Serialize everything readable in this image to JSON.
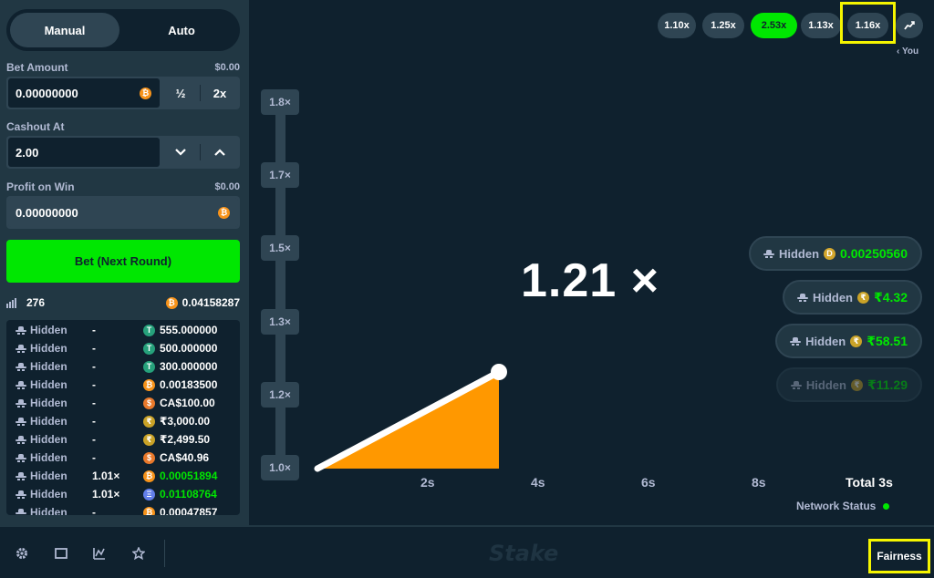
{
  "sidebar": {
    "modes": [
      "Manual",
      "Auto"
    ],
    "bet_amount": {
      "label": "Bet Amount",
      "usd": "$0.00",
      "value": "0.00000000",
      "half": "½",
      "double": "2x"
    },
    "cashout": {
      "label": "Cashout At",
      "value": "2.00"
    },
    "profit": {
      "label": "Profit on Win",
      "usd": "$0.00",
      "value": "0.00000000"
    },
    "bet_button": "Bet (Next Round)",
    "players": {
      "count": "276",
      "total": "0.04158287"
    },
    "bets": [
      {
        "user": "Hidden",
        "mult": "-",
        "coin": "usdt",
        "amount": "555.000000",
        "win": false
      },
      {
        "user": "Hidden",
        "mult": "-",
        "coin": "usdt",
        "amount": "500.000000",
        "win": false
      },
      {
        "user": "Hidden",
        "mult": "-",
        "coin": "usdt",
        "amount": "300.000000",
        "win": false
      },
      {
        "user": "Hidden",
        "mult": "-",
        "coin": "btc",
        "amount": "0.00183500",
        "win": false
      },
      {
        "user": "Hidden",
        "mult": "-",
        "coin": "cad",
        "amount": "CA$100.00",
        "win": false
      },
      {
        "user": "Hidden",
        "mult": "-",
        "coin": "inr",
        "amount": "₹3,000.00",
        "win": false
      },
      {
        "user": "Hidden",
        "mult": "-",
        "coin": "inr",
        "amount": "₹2,499.50",
        "win": false
      },
      {
        "user": "Hidden",
        "mult": "-",
        "coin": "cad",
        "amount": "CA$40.96",
        "win": false
      },
      {
        "user": "Hidden",
        "mult": "1.01×",
        "coin": "btc",
        "amount": "0.00051894",
        "win": true
      },
      {
        "user": "Hidden",
        "mult": "1.01×",
        "coin": "eth",
        "amount": "0.01108764",
        "win": true
      },
      {
        "user": "Hidden",
        "mult": "-",
        "coin": "btc",
        "amount": "0.00047857",
        "win": false
      }
    ]
  },
  "game": {
    "history": [
      "1.10x",
      "1.25x",
      "2.53x",
      "1.13x",
      "1.16x"
    ],
    "you_label": "You",
    "multiplier": "1.21 ×",
    "y_ticks": [
      "1.8×",
      "1.7×",
      "1.5×",
      "1.3×",
      "1.2×",
      "1.0×"
    ],
    "x_ticks": [
      "2s",
      "4s",
      "6s",
      "8s"
    ],
    "total": "Total 3s",
    "network_status": "Network Status",
    "cashouts": [
      {
        "name": "Hidden",
        "coin": "dai",
        "value": "0.00250560"
      },
      {
        "name": "Hidden",
        "coin": "inr",
        "value": "₹4.32"
      },
      {
        "name": "Hidden",
        "coin": "inr",
        "value": "₹58.51"
      },
      {
        "name": "Hidden",
        "coin": "inr",
        "value": "₹11.29"
      }
    ],
    "accent_green": "#00e701",
    "accent_orange": "#ff9800"
  },
  "footer": {
    "logo": "Stake",
    "fairness": "Fairness",
    "icons": [
      "gear-icon",
      "theatre-icon",
      "stats-icon",
      "star-icon"
    ]
  }
}
